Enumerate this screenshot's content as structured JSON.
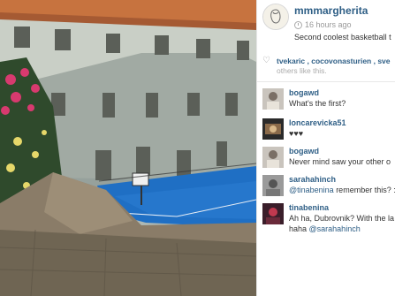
{
  "post": {
    "username": "mmmargherita",
    "time_ago": "16 hours ago",
    "caption": "Second coolest basketball t"
  },
  "likes": {
    "likers": "tvekaric , cocovonasturien , sve",
    "more": "others like this."
  },
  "comments": [
    {
      "user": "bogawd",
      "text": "What's the first?"
    },
    {
      "user": "loncarevicka51",
      "text": "♥♥♥"
    },
    {
      "user": "bogawd",
      "text": "Never mind saw your other o"
    },
    {
      "user": "sarahahinch",
      "mention": "@tinabenina",
      "text": " remember this? :"
    },
    {
      "user": "tinabenina",
      "text": "Ah ha, Dubrovnik? With the la",
      "line2_text": "haha ",
      "line2_mention": "@sarahahinch"
    }
  ],
  "colors": {
    "link": "#2f5f86",
    "court": "#1f6fc4"
  }
}
